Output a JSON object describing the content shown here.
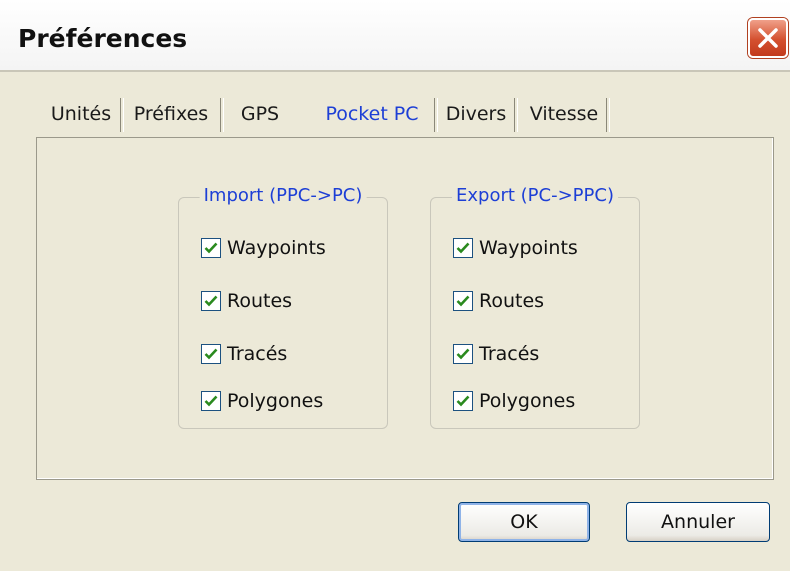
{
  "window": {
    "title": "Préférences"
  },
  "tabs": [
    {
      "label": "Unités"
    },
    {
      "label": "Préfixes"
    },
    {
      "label": "GPS"
    },
    {
      "label": "Pocket PC",
      "active": true
    },
    {
      "label": "Divers"
    },
    {
      "label": "Vitesse"
    }
  ],
  "import_group": {
    "title": "Import (PPC->PC)",
    "items": [
      {
        "label": "Waypoints",
        "checked": true
      },
      {
        "label": "Routes",
        "checked": true
      },
      {
        "label": "Tracés",
        "checked": true
      },
      {
        "label": "Polygones",
        "checked": true
      }
    ]
  },
  "export_group": {
    "title": "Export (PC->PPC)",
    "items": [
      {
        "label": "Waypoints",
        "checked": true
      },
      {
        "label": "Routes",
        "checked": true
      },
      {
        "label": "Tracés",
        "checked": true
      },
      {
        "label": "Polygones",
        "checked": true
      }
    ]
  },
  "buttons": {
    "ok": "OK",
    "cancel": "Annuler"
  },
  "colors": {
    "accent": "#1d3fd6",
    "check": "#2a8a1e",
    "close": "#d4502f",
    "face": "#ece9d8"
  },
  "icons": {
    "close": "close-icon",
    "check": "check-icon"
  }
}
